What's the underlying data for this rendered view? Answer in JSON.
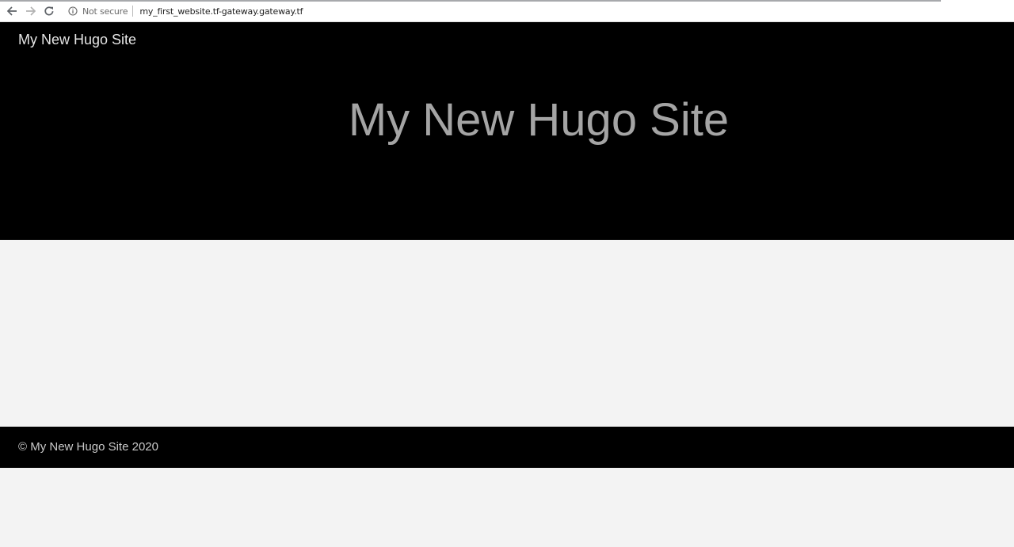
{
  "browser": {
    "security_label": "Not secure",
    "url": "my_first_website.tf-gateway.gateway.tf",
    "icons": {
      "back": "arrow-left-icon",
      "forward": "arrow-right-icon",
      "reload": "reload-icon",
      "info": "info-icon"
    }
  },
  "site": {
    "brand": "My New Hugo Site",
    "hero_title": "My New Hugo Site"
  },
  "footer": {
    "copyright": "© My New Hugo Site 2020"
  },
  "colors": {
    "header_bg": "#000000",
    "page_bg": "#f3f3f3",
    "hero_title": "#a4a4a4",
    "brand_text": "#e6e6e6",
    "footer_text": "#c9c9c9"
  }
}
